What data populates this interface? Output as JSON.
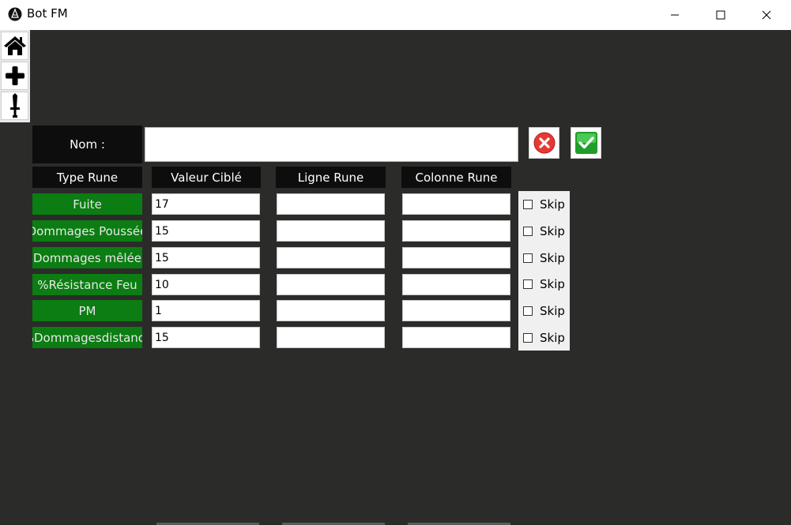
{
  "window": {
    "title": "Bot FM",
    "minimize_glyph": "—",
    "maximize_glyph": "☐",
    "close_glyph": "✕"
  },
  "nav": {
    "home_icon": "home-icon",
    "add_icon": "plus-icon",
    "tool_icon": "sword-icon"
  },
  "form": {
    "name_label": "Nom :",
    "name_value": "",
    "cancel_icon": "cancel-icon",
    "confirm_icon": "confirm-icon"
  },
  "table": {
    "headers": [
      "Type Rune",
      "Valeur Ciblé",
      "Ligne Rune",
      "Colonne Rune"
    ],
    "rows": [
      {
        "type": "Fuite",
        "value": "17",
        "ligne": "",
        "colonne": "",
        "skip_label": "Skip",
        "skip_checked": false
      },
      {
        "type": "Dommages Poussée",
        "value": "15",
        "ligne": "",
        "colonne": "",
        "skip_label": "Skip",
        "skip_checked": false
      },
      {
        "type": "Dommages mêlée",
        "value": "15",
        "ligne": "",
        "colonne": "",
        "skip_label": "Skip",
        "skip_checked": false
      },
      {
        "type": "%Résistance Feu",
        "value": "10",
        "ligne": "",
        "colonne": "",
        "skip_label": "Skip",
        "skip_checked": false
      },
      {
        "type": "PM",
        "value": "1",
        "ligne": "",
        "colonne": "",
        "skip_label": "Skip",
        "skip_checked": false
      },
      {
        "type": "%Dommagesdistance",
        "value": "15",
        "ligne": "",
        "colonne": "",
        "skip_label": "Skip",
        "skip_checked": false
      }
    ]
  },
  "colors": {
    "background": "#2b2b29",
    "label_bg": "#0d0d0d",
    "rune_type_bg": "#0b7d12",
    "cancel_red": "#e53935",
    "confirm_green": "#1f9d28"
  }
}
